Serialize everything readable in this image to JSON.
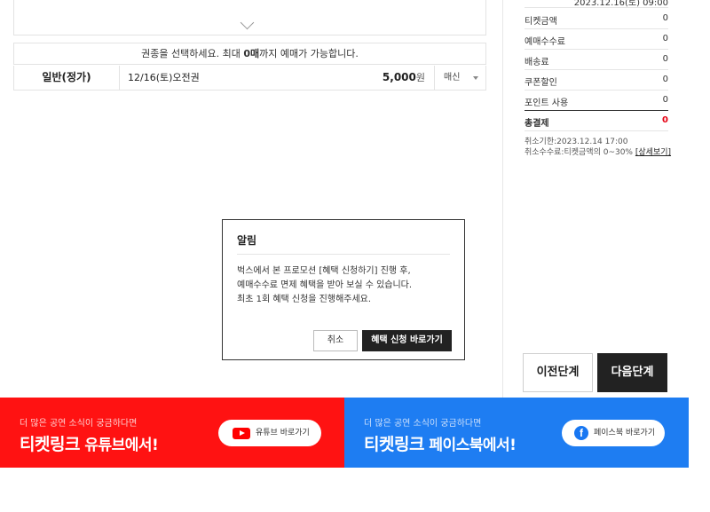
{
  "selection": {
    "notice_prefix": "권종을 선택하세요. 최대 ",
    "notice_max": "0매",
    "notice_suffix": "까지 예매가 가능합니다.",
    "ticket": {
      "type": "일반(정가)",
      "date": "12/16(토)오전권",
      "price": "5,000",
      "price_unit": "원",
      "select_value": "매신"
    }
  },
  "summary": {
    "partial_date": "2023.12.16(토) 09:00",
    "rows": [
      {
        "label": "티켓금액",
        "value": "0"
      },
      {
        "label": "예매수수료",
        "value": "0"
      },
      {
        "label": "배송료",
        "value": "0"
      },
      {
        "label": "쿠폰할인",
        "value": "0"
      },
      {
        "label": "포인트 사용",
        "value": "0"
      }
    ],
    "total_label": "총결제",
    "total_value": "0",
    "cancel_deadline_label": "취소기한",
    "cancel_deadline": "2023.12.14 17:00",
    "cancel_fee_label": "취소수수료",
    "cancel_fee": "티켓금액의 0~30%",
    "detail_link": "[상세보기]"
  },
  "buttons": {
    "prev": "이전단계",
    "next": "다음단계"
  },
  "modal": {
    "title": "알림",
    "line1": "벅스에서 본 프로모션 [혜택 신청하기] 진행 후,",
    "line2": "예매수수료 면제 혜택을 받아 보실 수 있습니다.",
    "line3": "최초 1회 혜택 신청을 진행해주세요.",
    "cancel": "취소",
    "go": "혜택 신청 바로가기"
  },
  "banners": {
    "youtube": {
      "sub": "더 많은 공연 소식이 궁금하다면",
      "brand": "티켓링크",
      "tail": " 유튜브에서!",
      "button": "유튜브 바로가기"
    },
    "facebook": {
      "sub": "더 많은 공연 소식이 궁금하다면",
      "brand": "티켓링크",
      "tail": " 페이스북에서!",
      "button": "페이스북 바로가기"
    }
  },
  "colors": {
    "accent_red": "#e60012",
    "youtube_bg": "#ff1212",
    "facebook_bg": "#1e7df2",
    "dark": "#222222"
  }
}
